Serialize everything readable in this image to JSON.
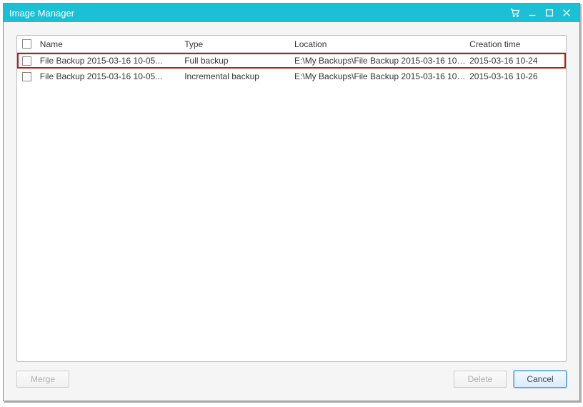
{
  "window": {
    "title": "Image Manager"
  },
  "columns": {
    "name": "Name",
    "type": "Type",
    "location": "Location",
    "creation_time": "Creation time"
  },
  "rows": [
    {
      "name": "File Backup 2015-03-16 10-05...",
      "type": "Full backup",
      "location": "E:\\My Backups\\File Backup 2015-03-16 10-...",
      "creation_time": "2015-03-16 10-24",
      "highlighted": true
    },
    {
      "name": "File Backup 2015-03-16 10-05...",
      "type": "Incremental backup",
      "location": "E:\\My Backups\\File Backup 2015-03-16 10-...",
      "creation_time": "2015-03-16 10-26",
      "highlighted": false
    }
  ],
  "buttons": {
    "merge": "Merge",
    "delete": "Delete",
    "cancel": "Cancel"
  }
}
